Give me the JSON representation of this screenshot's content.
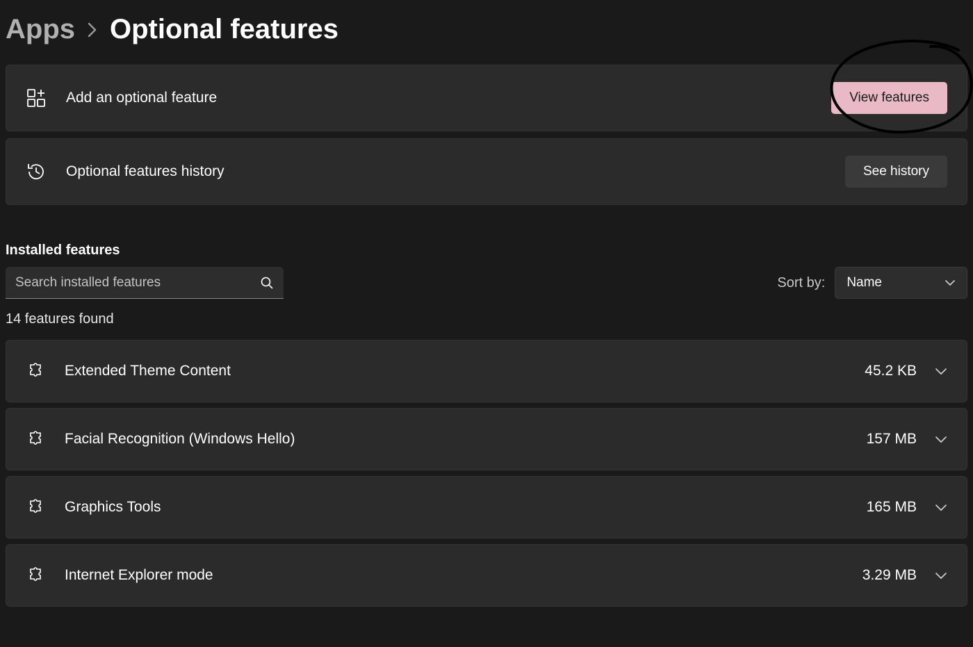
{
  "breadcrumb": {
    "parent": "Apps",
    "current": "Optional features"
  },
  "cards": {
    "add": {
      "label": "Add an optional feature",
      "button": "View features"
    },
    "history": {
      "label": "Optional features history",
      "button": "See history"
    }
  },
  "section_heading": "Installed features",
  "search": {
    "placeholder": "Search installed features",
    "value": ""
  },
  "sort": {
    "label": "Sort by:",
    "selected": "Name"
  },
  "count_line": "14 features found",
  "features": [
    {
      "name": "Extended Theme Content",
      "size": "45.2 KB"
    },
    {
      "name": "Facial Recognition (Windows Hello)",
      "size": "157 MB"
    },
    {
      "name": "Graphics Tools",
      "size": "165 MB"
    },
    {
      "name": "Internet Explorer mode",
      "size": "3.29 MB"
    }
  ],
  "colors": {
    "accent": "#e9b9c6",
    "card_bg": "#2b2b2b",
    "page_bg": "#1a1a1a"
  }
}
